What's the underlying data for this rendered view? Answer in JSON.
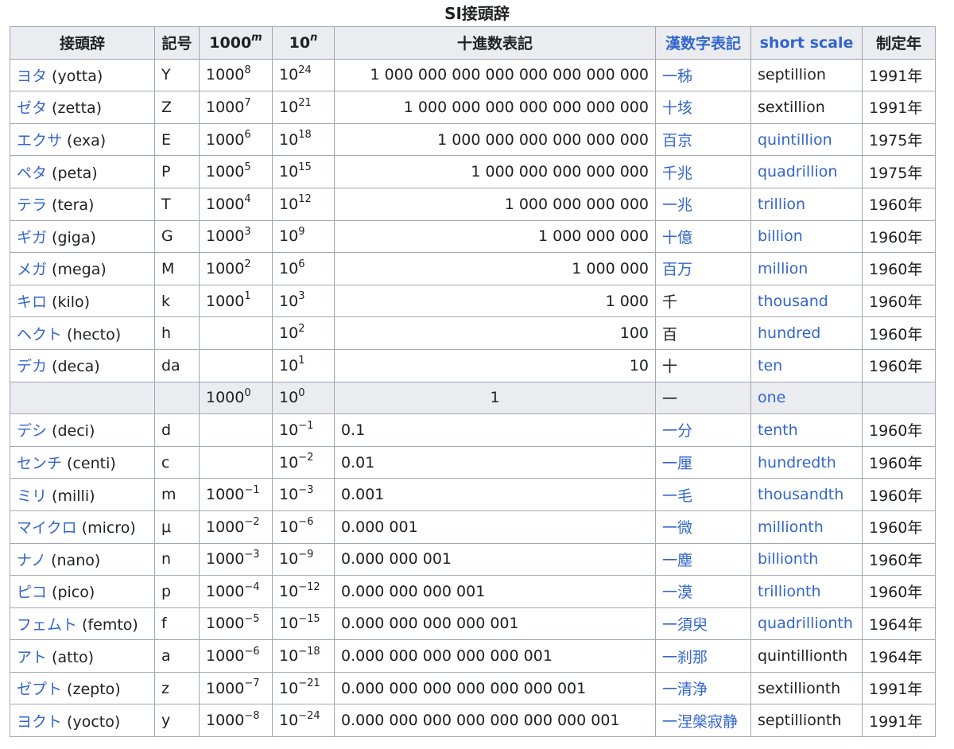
{
  "caption": "SI接頭辞",
  "headers": {
    "prefix": "接頭辞",
    "symbol": "記号",
    "pow1000_base": "1000",
    "pow1000_exp": "m",
    "pow10_base": "10",
    "pow10_exp": "n",
    "decimal": "十進数表記",
    "kanji": "漢数字表記",
    "short_scale": "short scale",
    "year": "制定年"
  },
  "rows": [
    {
      "kana": "ヨタ",
      "latin": " (yotta)",
      "symbol": "Y",
      "m": "8",
      "n": "24",
      "decimal": "1 000 000 000 000 000 000 000 000",
      "align": "right",
      "kanji": "一秭",
      "kanji_link": true,
      "short": "septillion",
      "short_link": false,
      "year": "1991年"
    },
    {
      "kana": "ゼタ",
      "latin": " (zetta)",
      "symbol": "Z",
      "m": "7",
      "n": "21",
      "decimal": "1 000 000 000 000 000 000 000",
      "align": "right",
      "kanji": "十垓",
      "kanji_link": true,
      "short": "sextillion",
      "short_link": false,
      "year": "1991年"
    },
    {
      "kana": "エクサ",
      "latin": " (exa)",
      "symbol": "E",
      "m": "6",
      "n": "18",
      "decimal": "1 000 000 000 000 000 000",
      "align": "right",
      "kanji": "百京",
      "kanji_link": true,
      "short": "quintillion",
      "short_link": true,
      "year": "1975年"
    },
    {
      "kana": "ペタ",
      "latin": " (peta)",
      "symbol": "P",
      "m": "5",
      "n": "15",
      "decimal": "1 000 000 000 000 000",
      "align": "right",
      "kanji": "千兆",
      "kanji_link": true,
      "short": "quadrillion",
      "short_link": true,
      "year": "1975年"
    },
    {
      "kana": "テラ",
      "latin": " (tera)",
      "symbol": "T",
      "m": "4",
      "n": "12",
      "decimal": "1 000 000 000 000",
      "align": "right",
      "kanji": "一兆",
      "kanji_link": true,
      "short": "trillion",
      "short_link": true,
      "year": "1960年"
    },
    {
      "kana": "ギガ",
      "latin": " (giga)",
      "symbol": "G",
      "m": "3",
      "n": "9",
      "decimal": "1 000 000 000",
      "align": "right",
      "kanji": "十億",
      "kanji_link": true,
      "short": "billion",
      "short_link": true,
      "year": "1960年"
    },
    {
      "kana": "メガ",
      "latin": " (mega)",
      "symbol": "M",
      "m": "2",
      "n": "6",
      "decimal": "1 000 000",
      "align": "right",
      "kanji": "百万",
      "kanji_link": true,
      "short": "million",
      "short_link": true,
      "year": "1960年"
    },
    {
      "kana": "キロ",
      "latin": " (kilo)",
      "symbol": "k",
      "m": "1",
      "n": "3",
      "decimal": "1 000",
      "align": "right",
      "kanji": "千",
      "kanji_link": false,
      "short": "thousand",
      "short_link": true,
      "year": "1960年"
    },
    {
      "kana": "ヘクト",
      "latin": " (hecto)",
      "symbol": "h",
      "m": "",
      "n": "2",
      "decimal": "100",
      "align": "right",
      "kanji": "百",
      "kanji_link": false,
      "short": "hundred",
      "short_link": true,
      "year": "1960年"
    },
    {
      "kana": "デカ",
      "latin": " (deca)",
      "symbol": "da",
      "m": "",
      "n": "1",
      "decimal": "10",
      "align": "right",
      "kanji": "十",
      "kanji_link": false,
      "short": "ten",
      "short_link": true,
      "year": "1960年"
    },
    {
      "kana": "",
      "latin": "",
      "symbol": "",
      "m": "0",
      "n": "0",
      "decimal": "1",
      "align": "center",
      "kanji": "一",
      "kanji_link": false,
      "short": "one",
      "short_link": true,
      "year": "",
      "gray": true
    },
    {
      "kana": "デシ",
      "latin": " (deci)",
      "symbol": "d",
      "m": "",
      "n": "−1",
      "decimal": "0.1",
      "align": "left",
      "kanji": "一分",
      "kanji_link": true,
      "short": "tenth",
      "short_link": true,
      "year": "1960年"
    },
    {
      "kana": "センチ",
      "latin": " (centi)",
      "symbol": "c",
      "m": "",
      "n": "−2",
      "decimal": "0.01",
      "align": "left",
      "kanji": "一厘",
      "kanji_link": true,
      "short": "hundredth",
      "short_link": true,
      "year": "1960年"
    },
    {
      "kana": "ミリ",
      "latin": " (milli)",
      "symbol": "m",
      "m": "−1",
      "n": "−3",
      "decimal": "0.001",
      "align": "left",
      "kanji": "一毛",
      "kanji_link": true,
      "short": "thousandth",
      "short_link": true,
      "year": "1960年"
    },
    {
      "kana": "マイクロ",
      "latin": " (micro)",
      "symbol": "μ",
      "m": "−2",
      "n": "−6",
      "decimal": "0.000 001",
      "align": "left",
      "kanji": "一微",
      "kanji_link": true,
      "short": "millionth",
      "short_link": true,
      "year": "1960年"
    },
    {
      "kana": "ナノ",
      "latin": " (nano)",
      "symbol": "n",
      "m": "−3",
      "n": "−9",
      "decimal": "0.000 000 001",
      "align": "left",
      "kanji": "一塵",
      "kanji_link": true,
      "short": "billionth",
      "short_link": true,
      "year": "1960年"
    },
    {
      "kana": "ピコ",
      "latin": " (pico)",
      "symbol": "p",
      "m": "−4",
      "n": "−12",
      "decimal": "0.000 000 000 001",
      "align": "left",
      "kanji": "一漠",
      "kanji_link": true,
      "short": "trillionth",
      "short_link": true,
      "year": "1960年"
    },
    {
      "kana": "フェムト",
      "latin": " (femto)",
      "symbol": "f",
      "m": "−5",
      "n": "−15",
      "decimal": "0.000 000 000 000 001",
      "align": "left",
      "kanji": "一須臾",
      "kanji_link": true,
      "short": "quadrillionth",
      "short_link": true,
      "year": "1964年"
    },
    {
      "kana": "アト",
      "latin": " (atto)",
      "symbol": "a",
      "m": "−6",
      "n": "−18",
      "decimal": "0.000 000 000 000 000 001",
      "align": "left",
      "kanji": "一刹那",
      "kanji_link": true,
      "short": "quintillionth",
      "short_link": false,
      "year": "1964年"
    },
    {
      "kana": "ゼプト",
      "latin": " (zepto)",
      "symbol": "z",
      "m": "−7",
      "n": "−21",
      "decimal": "0.000 000 000 000 000 000 001",
      "align": "left",
      "kanji": "一清浄",
      "kanji_link": true,
      "short": "sextillionth",
      "short_link": false,
      "year": "1991年"
    },
    {
      "kana": "ヨクト",
      "latin": " (yocto)",
      "symbol": "y",
      "m": "−8",
      "n": "−24",
      "decimal": "0.000 000 000 000 000 000 000 001",
      "align": "left",
      "kanji": "一涅槃寂静",
      "kanji_link": true,
      "short": "septillionth",
      "short_link": false,
      "year": "1991年"
    }
  ]
}
